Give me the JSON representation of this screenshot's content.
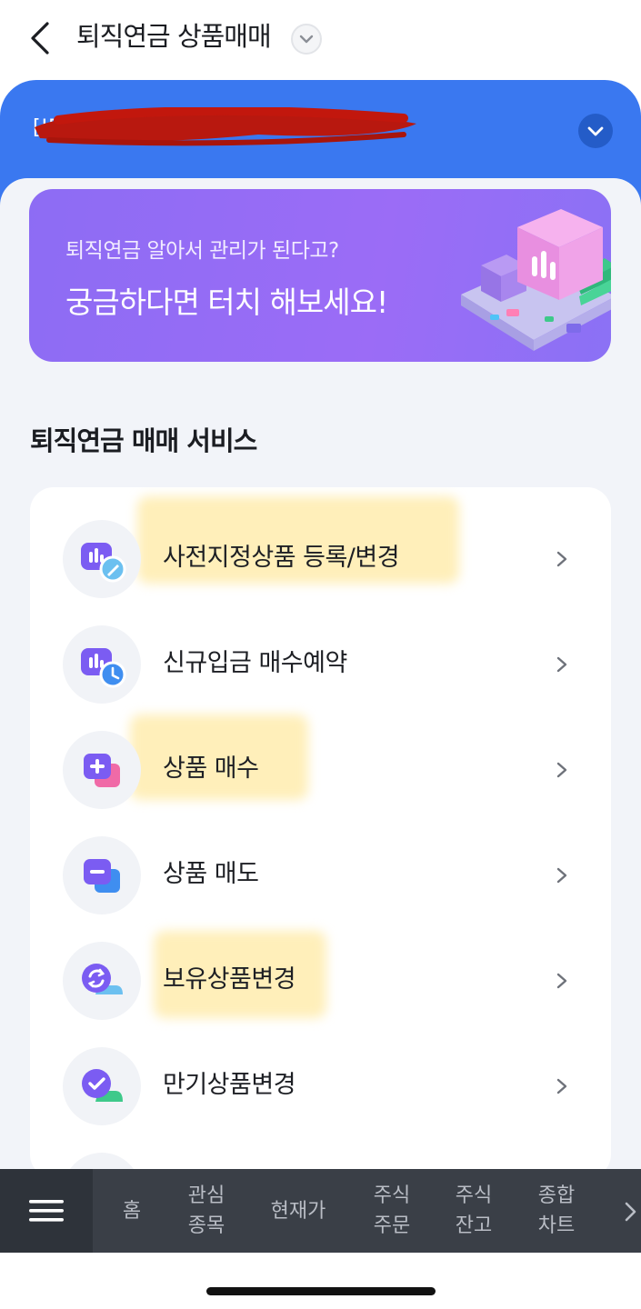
{
  "header": {
    "title": "퇴직연금 상품매매"
  },
  "account": {
    "label": "[IRP]"
  },
  "banner": {
    "subtitle": "퇴직연금 알아서 관리가 된다고?",
    "headline": "궁금하다면 터치 해보세요!"
  },
  "section": {
    "title": "퇴직연금 매매 서비스"
  },
  "services": [
    {
      "label": "사전지정상품 등록/변경",
      "icon": "chart-edit-icon"
    },
    {
      "label": "신규입금 매수예약",
      "icon": "chart-clock-icon"
    },
    {
      "label": "상품 매수",
      "icon": "plus-square-icon"
    },
    {
      "label": "상품 매도",
      "icon": "minus-square-icon"
    },
    {
      "label": "보유상품변경",
      "icon": "swap-icon"
    },
    {
      "label": "만기상품변경",
      "icon": "check-icon"
    }
  ],
  "bottom_nav": {
    "items": [
      {
        "line1": "홈",
        "line2": ""
      },
      {
        "line1": "관심",
        "line2": "종목"
      },
      {
        "line1": "현재가",
        "line2": ""
      },
      {
        "line1": "주식",
        "line2": "주문"
      },
      {
        "line1": "주식",
        "line2": "잔고"
      },
      {
        "line1": "종합",
        "line2": "차트"
      }
    ]
  },
  "colors": {
    "brand_blue": "#3a78f0",
    "banner_purple": "#9b6cf6",
    "icon_purple": "#7c5cf2",
    "nav_bg": "#3a3f47"
  }
}
